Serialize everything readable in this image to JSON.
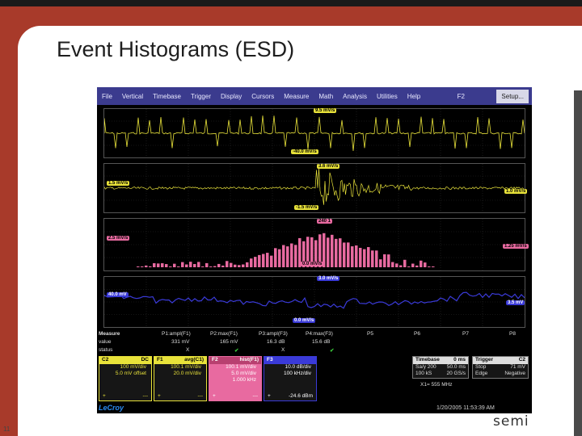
{
  "slide": {
    "title": "Event Histograms (ESD)",
    "number": "11",
    "brand": "semi"
  },
  "menu": [
    "File",
    "Vertical",
    "Timebase",
    "Trigger",
    "Display",
    "Cursors",
    "Measure",
    "Math",
    "Analysis",
    "Utilities",
    "Help"
  ],
  "menu_right": {
    "f2": "F2",
    "setup": "Setup..."
  },
  "traces": {
    "c1_top_label": "9.5 mV/s",
    "c1_bottom_label": "-40.0 mV/s",
    "c2_top_label": "3.6 mV/s",
    "c2_left_label": "1.5 mV/s",
    "c2_right_label": "1.0 mV/s",
    "c2_bottom_label": "-1.5 mV/s",
    "hist_top_label": "240 1",
    "hist_left_label": "2.5 mV/s",
    "hist_right_label": "1.25 mV/s",
    "hist_bottom_label": "0.0 mV/s",
    "track_top_label": "3.0 mV/s",
    "track_left_label": "40.0 mV",
    "track_right_label": "3.5 mV",
    "track_bottom_label": "0.0 mV/s"
  },
  "measure": {
    "header": [
      "Measure",
      "P1:ampl(F1)",
      "P2:max(F1)",
      "P3:ampl(F3)",
      "P4:max(F3)",
      "P5",
      "P6",
      "P7",
      "P8"
    ],
    "value_label": "value",
    "status_label": "status",
    "values": [
      "331 mV",
      "165 mV",
      "16.3 dB",
      "15.6 dB"
    ],
    "status": [
      "X",
      "✔",
      "X",
      "✔"
    ]
  },
  "descriptors": {
    "c2": {
      "head": "C2",
      "tag": "DC",
      "l1": "100 mV/div",
      "l2": "5.0 mV offset",
      "foot_l": "+",
      "foot_r": "---"
    },
    "f1": {
      "head": "F1",
      "tag": "avg(C1)",
      "l1": "100.1 mV/div",
      "l2": "20.0 mV/div",
      "foot_l": "+",
      "foot_r": "---"
    },
    "f2": {
      "head": "F2",
      "tag": "hist(F1)",
      "l1": "100.1 mV/div",
      "l2": "5.0 mV/div",
      "l3": "1.000 kHz",
      "foot_l": "+",
      "foot_r": "---"
    },
    "f3": {
      "head": "F3",
      "tag": "",
      "l1": "10.0 dB/div",
      "l2": "100 kHz/div",
      "foot_l": "+",
      "foot_r": "-24.6 dBm"
    },
    "timebase": {
      "head": "Timebase",
      "head_val": "0 ms",
      "l1": "Sa/y 200",
      "l1v": "50.0 ms",
      "l2": "100 kS",
      "l2v": "20 GS/s"
    },
    "trigger": {
      "head": "Trigger",
      "head_val": "C2",
      "l1": "Stop",
      "l1v": "71 mV",
      "l2": "Edge",
      "l2v": "Negative"
    },
    "extra": "X1= 555 MHz"
  },
  "footer": {
    "logo": "LeCroy",
    "clock": "1/20/2005 11:53:39 AM"
  },
  "colors": {
    "c1": "#e8e23a",
    "hist": "#e86aa0",
    "track": "#3a3ad8",
    "menu": "#3b3b8e",
    "frame": "#a83a2a"
  }
}
